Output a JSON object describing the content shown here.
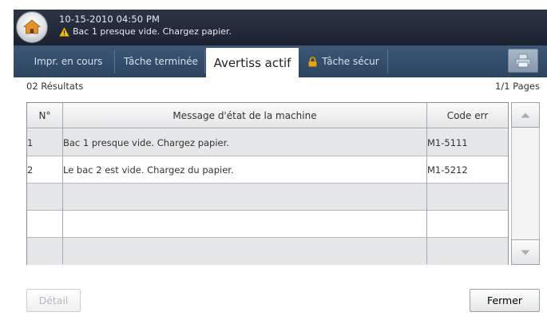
{
  "status": {
    "datetime": "10-15-2010 04:50 PM",
    "message": "Bac 1 presque vide. Chargez papier."
  },
  "tabs": [
    {
      "label": "Impr. en cours"
    },
    {
      "label": "Tâche terminée"
    },
    {
      "label": "Avertiss actif"
    },
    {
      "label": "Tâche sécur"
    }
  ],
  "results": {
    "count_label": "02 Résultats",
    "pages_label": "1/1 Pages"
  },
  "table": {
    "headers": {
      "num": "N°",
      "message": "Message d'état de la machine",
      "code": "Code err"
    },
    "rows": [
      {
        "num": "1",
        "message": "Bac 1 presque vide. Chargez papier.",
        "code": "M1-5111"
      },
      {
        "num": "2",
        "message": "Le bac 2 est vide. Chargez du papier.",
        "code": "M1-5212"
      },
      {
        "num": "",
        "message": "",
        "code": ""
      },
      {
        "num": "",
        "message": "",
        "code": ""
      },
      {
        "num": "",
        "message": "",
        "code": ""
      }
    ]
  },
  "buttons": {
    "detail": "Détail",
    "close": "Fermer"
  },
  "icons": {
    "home": "home-icon",
    "warning": "warning-icon",
    "lock": "lock-icon",
    "print": "print-icon",
    "scroll_up": "triangle-up-icon",
    "scroll_down": "triangle-down-icon"
  },
  "colors": {
    "topbar": "#232a38",
    "tabbar": "#344e6b",
    "warning": "#f2c200",
    "lock": "#e8a200"
  }
}
